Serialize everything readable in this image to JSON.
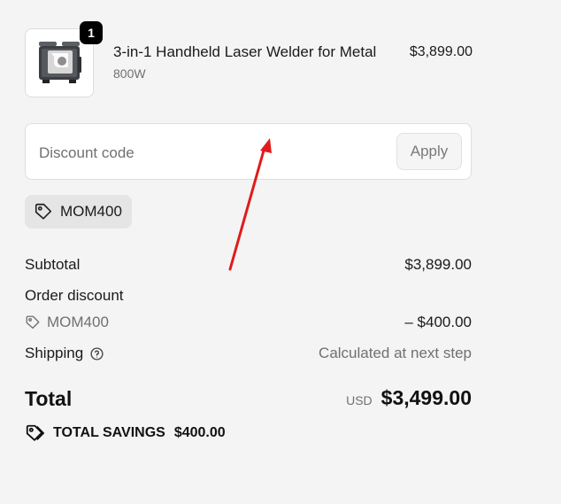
{
  "product": {
    "quantity": "1",
    "name": "3-in-1 Handheld Laser Welder for Metal",
    "variant": "800W",
    "price": "$3,899.00",
    "image_icon": "laser-welder-machine"
  },
  "discount": {
    "placeholder": "Discount code",
    "value": "",
    "apply_label": "Apply",
    "applied_code": "MOM400"
  },
  "summary": {
    "subtotal_label": "Subtotal",
    "subtotal_value": "$3,899.00",
    "order_discount_label": "Order discount",
    "discount_code": "MOM400",
    "discount_value": "– $400.00",
    "shipping_label": "Shipping",
    "shipping_value": "Calculated at next step",
    "total_label": "Total",
    "currency": "USD",
    "total_value": "$3,499.00",
    "savings_label": "TOTAL SAVINGS",
    "savings_value": "$400.00"
  },
  "annotation": {
    "arrow_color": "#e11b1b"
  }
}
